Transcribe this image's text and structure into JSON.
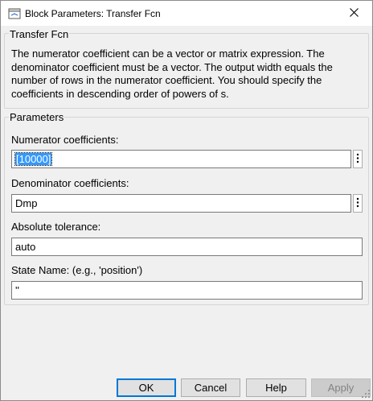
{
  "window": {
    "title": "Block Parameters: Transfer Fcn",
    "app_icon": "simulink-block-icon",
    "close_icon": "close-icon"
  },
  "description_group": {
    "label": "Transfer Fcn",
    "text": "The numerator coefficient can be a vector or matrix expression. The denominator coefficient must be a vector. The output width equals the number of rows in the numerator coefficient. You should specify the coefficients in descending order of powers of s."
  },
  "parameters_group": {
    "label": "Parameters",
    "numerator": {
      "label": "Numerator coefficients:",
      "value": "[10000]"
    },
    "denominator": {
      "label": "Denominator coefficients:",
      "value": "Dmp"
    },
    "tolerance": {
      "label": "Absolute tolerance:",
      "value": "auto"
    },
    "state_name": {
      "label": "State Name: (e.g., 'position')",
      "value": "''"
    }
  },
  "buttons": {
    "ok": "OK",
    "cancel": "Cancel",
    "help": "Help",
    "apply": "Apply"
  },
  "colors": {
    "selection": "#3399ff",
    "default_button_border": "#0078d7",
    "dialog_bg": "#f0f0f0"
  }
}
